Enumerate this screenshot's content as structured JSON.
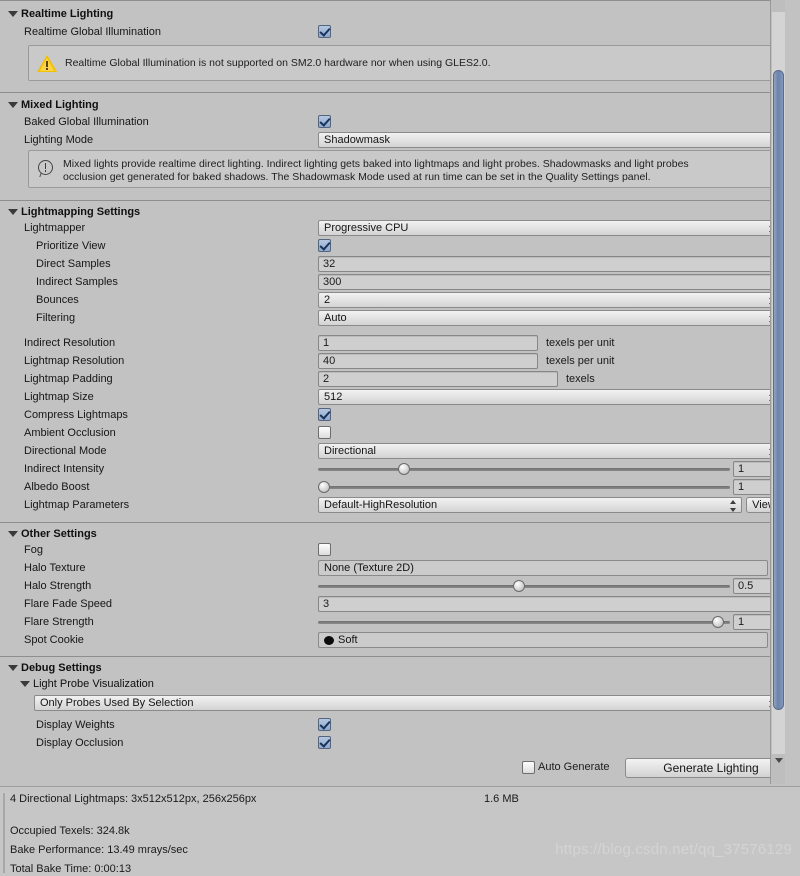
{
  "sections": {
    "realtime_lighting": {
      "title": "Realtime Lighting",
      "realtime_gi_label": "Realtime Global Illumination",
      "realtime_gi_checked": true,
      "warning": "Realtime Global Illumination is not supported on SM2.0 hardware nor when using GLES2.0."
    },
    "mixed_lighting": {
      "title": "Mixed Lighting",
      "baked_gi_label": "Baked Global Illumination",
      "baked_gi_checked": true,
      "lighting_mode_label": "Lighting Mode",
      "lighting_mode_value": "Shadowmask",
      "info_line1": "Mixed lights provide realtime direct lighting. Indirect lighting gets baked into lightmaps and light probes. Shadowmasks and light probes",
      "info_line2": "occlusion get generated for baked shadows. The Shadowmask Mode used at run time can be set in the Quality Settings panel."
    },
    "lightmapping_settings": {
      "title": "Lightmapping Settings",
      "lightmapper_label": "Lightmapper",
      "lightmapper_value": "Progressive CPU",
      "prioritize_view_label": "Prioritize View",
      "prioritize_view_checked": true,
      "direct_samples_label": "Direct Samples",
      "direct_samples_value": "32",
      "indirect_samples_label": "Indirect Samples",
      "indirect_samples_value": "300",
      "bounces_label": "Bounces",
      "bounces_value": "2",
      "filtering_label": "Filtering",
      "filtering_value": "Auto",
      "indirect_resolution_label": "Indirect Resolution",
      "indirect_resolution_value": "1",
      "indirect_resolution_unit": "texels per unit",
      "lightmap_resolution_label": "Lightmap Resolution",
      "lightmap_resolution_value": "40",
      "lightmap_resolution_unit": "texels per unit",
      "lightmap_padding_label": "Lightmap Padding",
      "lightmap_padding_value": "2",
      "lightmap_padding_unit": "texels",
      "lightmap_size_label": "Lightmap Size",
      "lightmap_size_value": "512",
      "compress_lightmaps_label": "Compress Lightmaps",
      "compress_lightmaps_checked": true,
      "ambient_occlusion_label": "Ambient Occlusion",
      "ambient_occlusion_checked": false,
      "directional_mode_label": "Directional Mode",
      "directional_mode_value": "Directional",
      "indirect_intensity_label": "Indirect Intensity",
      "indirect_intensity_value": "1",
      "indirect_intensity_percent": 20,
      "albedo_boost_label": "Albedo Boost",
      "albedo_boost_value": "1",
      "albedo_boost_percent": 0,
      "lightmap_parameters_label": "Lightmap Parameters",
      "lightmap_parameters_value": "Default-HighResolution",
      "view_button": "View"
    },
    "other_settings": {
      "title": "Other Settings",
      "fog_label": "Fog",
      "fog_checked": false,
      "halo_texture_label": "Halo Texture",
      "halo_texture_value": "None (Texture 2D)",
      "halo_strength_label": "Halo Strength",
      "halo_strength_value": "0.5",
      "halo_strength_percent": 49,
      "flare_fade_speed_label": "Flare Fade Speed",
      "flare_fade_speed_value": "3",
      "flare_strength_label": "Flare Strength",
      "flare_strength_value": "1",
      "flare_strength_percent": 99,
      "spot_cookie_label": "Spot Cookie",
      "spot_cookie_value": "Soft"
    },
    "debug_settings": {
      "title": "Debug Settings",
      "light_probe_visualization_label": "Light Probe Visualization",
      "light_probe_visualization_value": "Only Probes Used By Selection",
      "display_weights_label": "Display Weights",
      "display_weights_checked": true,
      "display_occlusion_label": "Display Occlusion",
      "display_occlusion_checked": true
    }
  },
  "footer": {
    "auto_generate_label": "Auto Generate",
    "auto_generate_checked": false,
    "generate_lighting_label": "Generate Lighting"
  },
  "stats": {
    "lightmaps_line": "4 Directional Lightmaps: 3x512x512px, 256x256px",
    "lightmaps_size": "1.6 MB",
    "occupied_texels": "Occupied Texels: 324.8k",
    "bake_performance": "Bake Performance: 13.49 mrays/sec",
    "total_bake_time": "Total Bake Time: 0:00:13"
  },
  "watermark": "https://blog.csdn.net/qq_37576129"
}
